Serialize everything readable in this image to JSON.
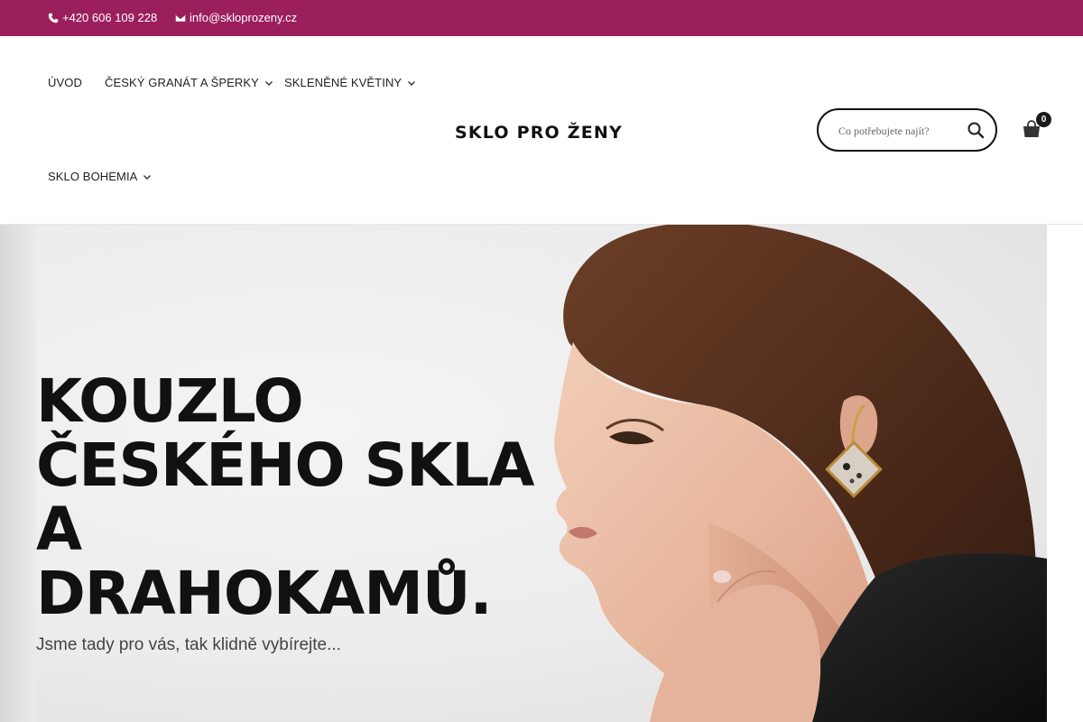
{
  "topbar": {
    "background": "#9c1f5d",
    "phone": "+420 606 109 228",
    "email": "info@skloprozeny.cz"
  },
  "nav": {
    "items": [
      {
        "label": "ÚVOD",
        "has_dropdown": false
      },
      {
        "label": "ČESKÝ GRANÁT A ŠPERKY",
        "has_dropdown": true
      },
      {
        "label": "SKLENĚNÉ KVĚTINY",
        "has_dropdown": true
      },
      {
        "label": "SKLO BOHEMIA",
        "has_dropdown": true
      }
    ]
  },
  "logo": {
    "text": "SKLO PRO ŽENY"
  },
  "search": {
    "placeholder": "Co potřebujete najít?",
    "value": ""
  },
  "cart": {
    "count": "0"
  },
  "hero": {
    "title_lines": [
      "KOUZLO",
      "ČESKÉHO SKLA",
      "A",
      "DRAHOKAMŮ."
    ],
    "subtitle": "Jsme tady pro vás, tak klidně vybírejte..."
  }
}
